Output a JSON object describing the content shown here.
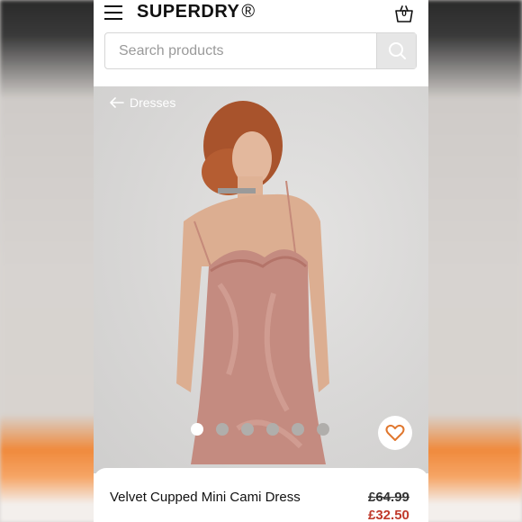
{
  "header": {
    "brand": "SUPERDRY",
    "brand_mark": "®",
    "basket_count": "0"
  },
  "search": {
    "placeholder": "Search products"
  },
  "breadcrumb": {
    "back_label": "Dresses"
  },
  "gallery": {
    "image_count": 6,
    "active_index": 0
  },
  "product": {
    "name": "Velvet Cupped Mini Cami Dress",
    "original_price": "£64.99",
    "sale_price": "£32.50"
  },
  "icons": {
    "menu": "hamburger-menu-icon",
    "basket": "basket-icon",
    "search": "search-icon",
    "back": "arrow-left-icon",
    "wishlist": "heart-icon"
  },
  "colors": {
    "accent": "#e0772e",
    "sale": "#c0392b"
  }
}
